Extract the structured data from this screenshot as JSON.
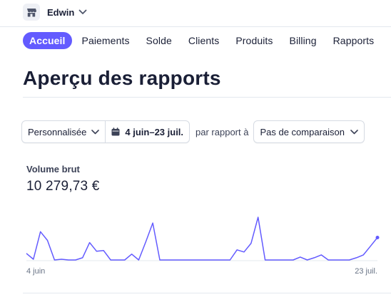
{
  "account": {
    "name": "Edwin",
    "icon": "store-icon"
  },
  "nav": {
    "items": [
      {
        "label": "Accueil",
        "active": true
      },
      {
        "label": "Paiements"
      },
      {
        "label": "Solde"
      },
      {
        "label": "Clients"
      },
      {
        "label": "Produits"
      },
      {
        "label": "Billing"
      },
      {
        "label": "Rapports"
      }
    ]
  },
  "page": {
    "title": "Aperçu des rapports"
  },
  "filters": {
    "range_preset": "Personnalisée",
    "date_range": "4 juin–23 juil.",
    "compare_label": "par rapport à",
    "compare_value": "Pas de comparaison"
  },
  "metric": {
    "label": "Volume brut",
    "value": "10 279,73 €"
  },
  "colors": {
    "accent": "#635bff",
    "line": "#635bff"
  },
  "chart_data": {
    "type": "line",
    "x_start_label": "4 juin",
    "x_end_label": "23 juil.",
    "values": [
      10,
      2,
      40,
      28,
      1,
      2,
      1,
      1,
      4,
      25,
      13,
      14,
      1,
      1,
      1,
      9,
      1,
      26,
      52,
      1,
      1,
      1,
      1,
      1,
      1,
      1,
      1,
      1,
      1,
      1,
      15,
      12,
      24,
      60,
      1,
      1,
      1,
      1,
      1,
      5,
      1,
      4,
      8,
      1,
      1,
      1,
      1,
      4,
      8,
      20,
      32
    ]
  }
}
